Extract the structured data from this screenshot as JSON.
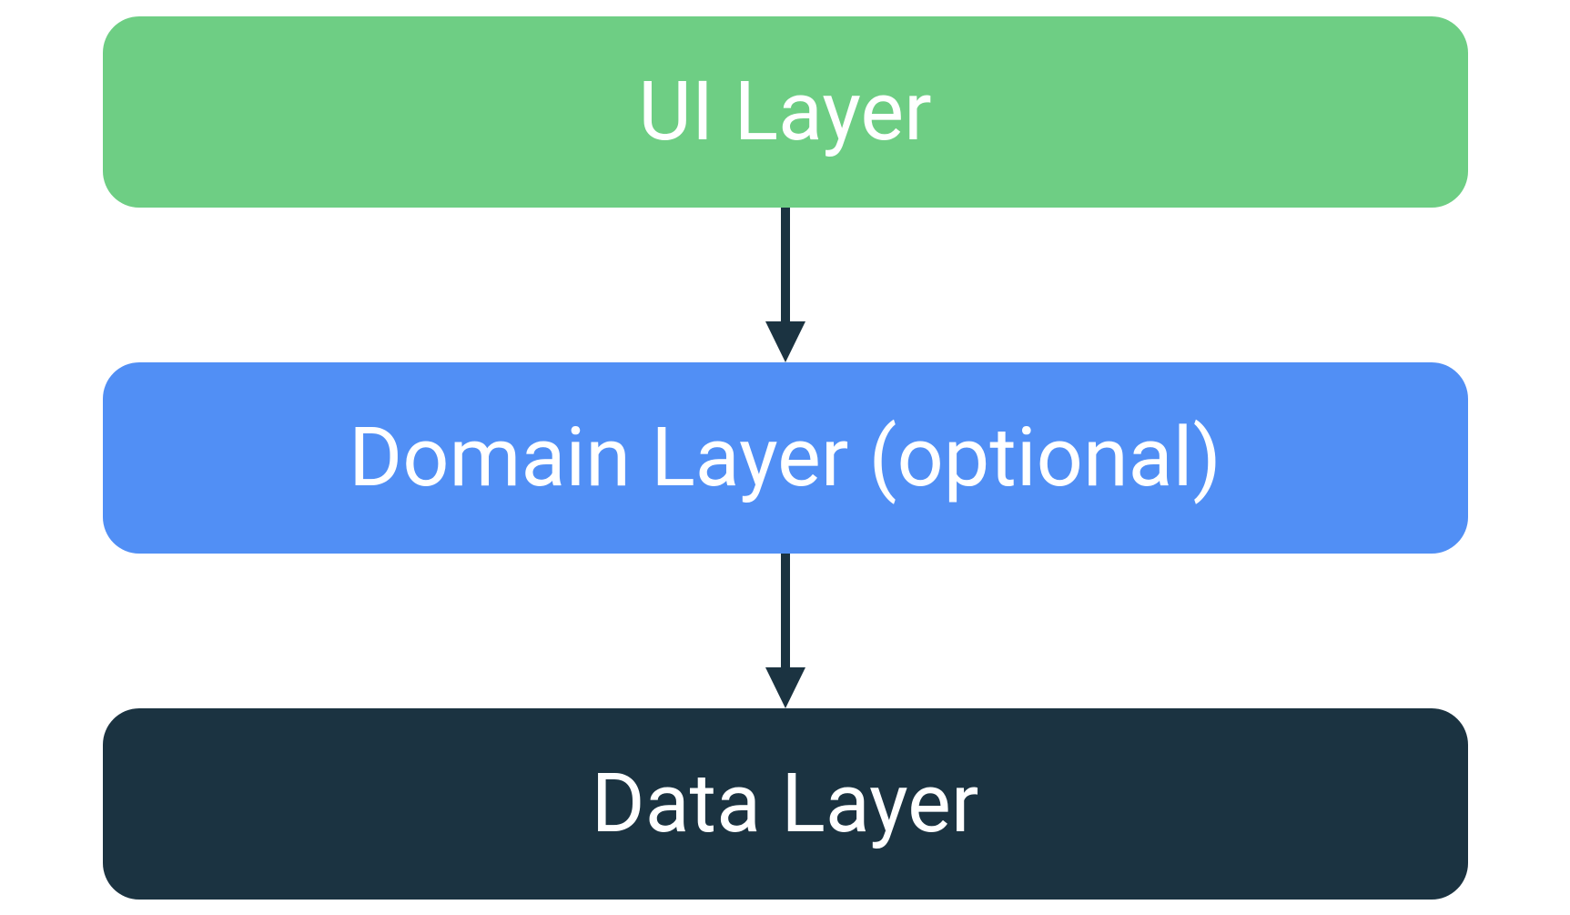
{
  "diagram": {
    "layers": [
      {
        "label": "UI Layer",
        "color": "#6ece84"
      },
      {
        "label": "Domain Layer (optional)",
        "color": "#518ff5"
      },
      {
        "label": "Data Layer",
        "color": "#1b3341"
      }
    ],
    "arrow_color": "#1b3341"
  }
}
